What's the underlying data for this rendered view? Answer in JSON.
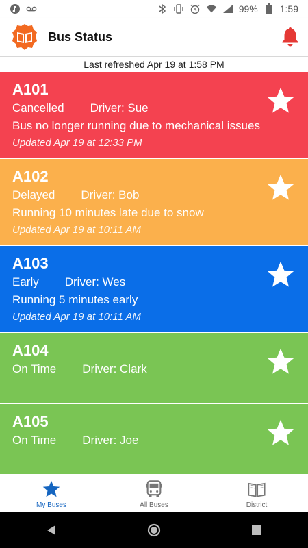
{
  "status_bar": {
    "battery": "99%",
    "time": "1:59"
  },
  "header": {
    "title": "Bus Status"
  },
  "refresh": {
    "text": "Last refreshed Apr 19 at 1:58 PM"
  },
  "buses": [
    {
      "route": "A101",
      "status": "Cancelled",
      "driver": "Driver: Sue",
      "message": "Bus no longer running due to mechanical issues",
      "updated": "Updated Apr 19 at 12:33 PM",
      "color": "#f44250"
    },
    {
      "route": "A102",
      "status": "Delayed",
      "driver": "Driver: Bob",
      "message": "Running 10 minutes late due to snow",
      "updated": "Updated Apr 19 at 10:11 AM",
      "color": "#fbb04c"
    },
    {
      "route": "A103",
      "status": "Early",
      "driver": "Driver: Wes",
      "message": "Running 5 minutes early",
      "updated": "Updated Apr 19 at 10:11 AM",
      "color": "#0a6ee8"
    },
    {
      "route": "A104",
      "status": "On Time",
      "driver": "Driver: Clark",
      "color": "#7ac554"
    },
    {
      "route": "A105",
      "status": "On Time",
      "driver": "Driver: Joe",
      "color": "#7ac554"
    }
  ],
  "bottom_nav": {
    "items": [
      {
        "label": "My Buses",
        "icon": "star-icon",
        "active": true
      },
      {
        "label": "All Buses",
        "icon": "bus-icon",
        "active": false
      },
      {
        "label": "District",
        "icon": "book-icon",
        "active": false
      }
    ]
  },
  "colors": {
    "accent": "#1565c0",
    "logo": "#f26a21",
    "bell": "#e53935"
  }
}
